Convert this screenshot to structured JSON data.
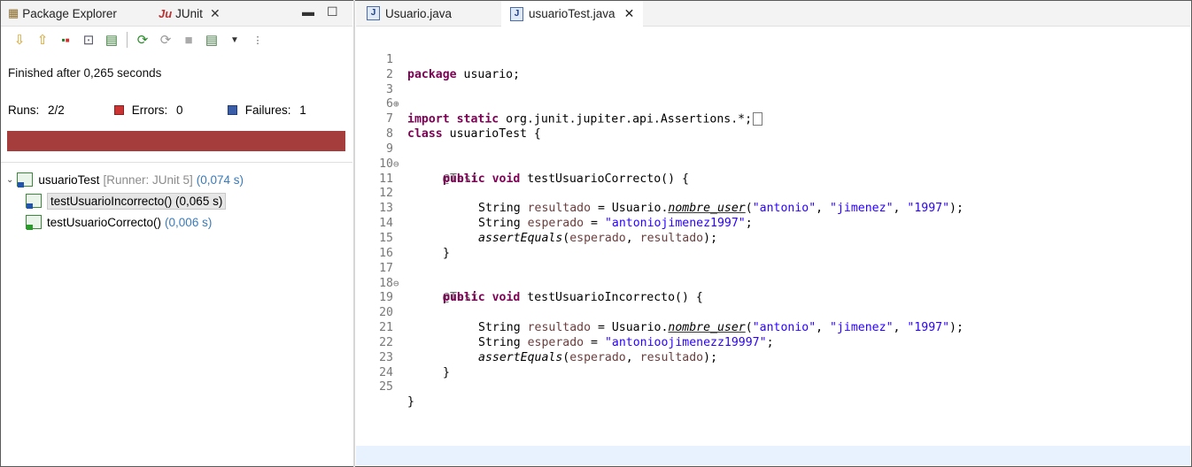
{
  "left_panel": {
    "tabs": {
      "package_explorer": "Package Explorer",
      "junit": "JUnit"
    },
    "status": "Finished after 0,265 seconds",
    "runs_label": "Runs:",
    "runs_value": "2/2",
    "errors_label": "Errors:",
    "errors_value": "0",
    "failures_label": "Failures:",
    "failures_value": "1",
    "progress_color": "#a53d3d",
    "tree": {
      "root_name": "usuarioTest",
      "root_runner": "[Runner: JUnit 5]",
      "root_time": "(0,074 s)",
      "children": [
        {
          "name": "testUsuarioIncorrecto() (0,065 s)",
          "status": "failure"
        },
        {
          "name": "testUsuarioCorrecto()",
          "time": "(0,006 s)",
          "status": "passed"
        }
      ]
    }
  },
  "editor": {
    "tabs": [
      "Usuario.java",
      "usuarioTest.java"
    ],
    "active_tab": "usuarioTest.java",
    "line_numbers": [
      "1",
      "2",
      "3",
      "6",
      "7",
      "8",
      "9",
      "10",
      "11",
      "12",
      "13",
      "14",
      "15",
      "16",
      "17",
      "18",
      "19",
      "20",
      "21",
      "22",
      "23",
      "24",
      "25"
    ],
    "code": {
      "pkg_kw": "package",
      "pkg_name": " usuario;",
      "import_kw": "import static",
      "import_path": " org.junit.jupiter.api.Assertions.*;",
      "class_kw": "class",
      "class_name": " usuarioTest {",
      "annotation": "@Test",
      "method_kw": "public void",
      "method1": " testUsuarioCorrecto() {",
      "method2": " testUsuarioIncorrecto() {",
      "string_type": "String ",
      "resultado": "resultado",
      "esperado": "esperado",
      "equals_usuario": " = Usuario.",
      "nombre_user": "nombre_user",
      "args_open": "(",
      "arg1": "\"antonio\"",
      "arg2": "\"jimenez\"",
      "arg3": "\"1997\"",
      "comma": ", ",
      "args_close": ");",
      "eq": " = ",
      "semi": ";",
      "expected1": "\"antoniojimenez1997\"",
      "expected2": "\"antonioojimenezz19997\"",
      "assert_call": "assertEquals",
      "assert_args_open": "(",
      "assert_args_sep": ", ",
      "assert_args_close": ");",
      "close_brace": "}",
      "close_brace_class": "}"
    }
  }
}
